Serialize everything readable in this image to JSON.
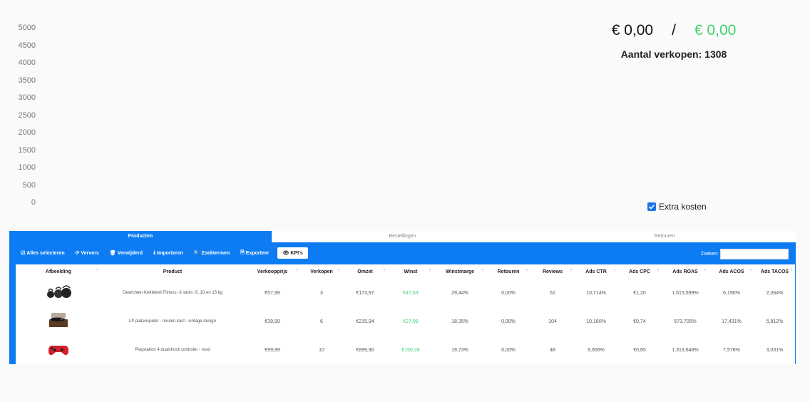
{
  "chart": {
    "y_ticks": [
      "5000",
      "4500",
      "4000",
      "3500",
      "3000",
      "2500",
      "2000",
      "1500",
      "1000",
      "500",
      "0"
    ]
  },
  "totals": {
    "left_value": "€ 0,00",
    "separator": "/",
    "right_value": "€ 0,00",
    "sales_label": "Aantal verkopen: 1308"
  },
  "extra_costs": {
    "label": "Extra kosten",
    "checked": true,
    "color": "#1a73e8"
  },
  "tabs": [
    {
      "label": "Producten",
      "active": true
    },
    {
      "label": "Bestellingen",
      "active": false
    },
    {
      "label": "Retouren",
      "active": false
    }
  ],
  "toolbar": {
    "select_all": "Alles selecteren",
    "refresh": "Ververs",
    "delete": "Verwijderd",
    "import": "Importeren",
    "keywords": "Zoektermen",
    "export": "Exporteer",
    "kpis": "KPI's",
    "search_label": "Zoeken:",
    "search_value": ""
  },
  "table": {
    "columns": [
      "Afbeelding",
      "Product",
      "Verkoopprijs",
      "Verkopen",
      "Omzet",
      "Winst",
      "Winstmarge",
      "Retouren",
      "Reviews",
      "Ads CTR",
      "Ads CPC",
      "Ads ROAS",
      "Ads ACOS",
      "Ads TACOS"
    ],
    "rows": [
      {
        "image": "kettlebells-image",
        "product": "Gewichten Kettlebell Fitness -3 stuks -5, 10 en 15 kg",
        "price": "€57,99",
        "sales": "3",
        "revenue": "€173,97",
        "profit": "€47,63",
        "margin": "29,44%",
        "returns": "0,00%",
        "reviews": "61",
        "ctr": "10,714%",
        "cpc": "€1,20",
        "roas": "1.615,599%",
        "acos": "6,190%",
        "tacos": "2,064%"
      },
      {
        "image": "record-player-image",
        "product": "LP platenspeler - houten kast  - vintage design",
        "price": "€39,99",
        "sales": "6",
        "revenue": "€215,94",
        "profit": "€27,08",
        "margin": "18,35%",
        "returns": "0,00%",
        "reviews": "104",
        "ctr": "10,180%",
        "cpc": "€0,74",
        "roas": "573,705%",
        "acos": "17,431%",
        "tacos": "5,812%"
      },
      {
        "image": "controller-image",
        "product": "Playstation 4 dualshock controler - rood",
        "price": "€99,99",
        "sales": "10",
        "revenue": "€899,90",
        "profit": "€150,28",
        "margin": "19,73%",
        "returns": "0,00%",
        "reviews": "46",
        "ctr": "9,906%",
        "cpc": "€0,65",
        "roas": "1.319,648%",
        "acos": "7,578%",
        "tacos": "3,031%"
      }
    ]
  },
  "colors": {
    "primary": "#0d7cf3",
    "profit_green": "#3dd26b"
  }
}
